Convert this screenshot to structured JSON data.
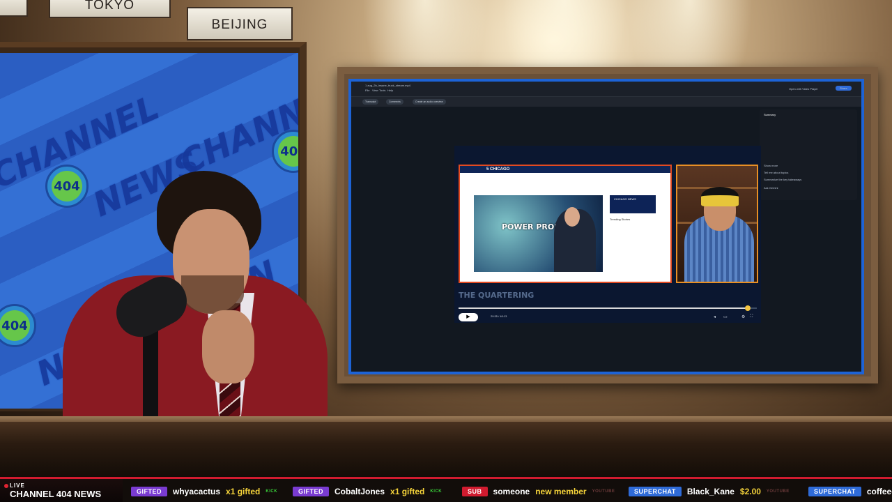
{
  "studio": {
    "clocks": [
      "TOKYO",
      "BEIJING"
    ],
    "backdrop_text": [
      "CHANNEL",
      "NEWS",
      "CHANNEL",
      "NEWS CHANN",
      "404"
    ]
  },
  "player": {
    "title": "1 aug_2b_insane_truck_stream.mp4",
    "menu": [
      "File",
      "View",
      "Tools",
      "Help"
    ],
    "open_with": "Open with Video Player",
    "share": "Share",
    "tabs": [
      "Transcript",
      "Comments",
      "Create an audio overview"
    ],
    "sidebar": {
      "heading": "Summary",
      "topics": [
        "Tell me about topics",
        "Summarize the key takeaways"
      ],
      "ask": "Ask Gemini",
      "show_more": "Show more"
    },
    "article": {
      "station": "5 CHICAGO",
      "headline": "POWER PROBLEMS",
      "side": "CHICAGO NEWS",
      "trending": "Trending Stories"
    },
    "channel_brand": "THE QUARTERING",
    "time": "29:35 / 40:13",
    "progress": 0.97
  },
  "ticker": {
    "live": "LIVE",
    "channel": "CHANNEL 404 NEWS",
    "items": [
      {
        "badge": "GIFTED",
        "badge_color": "#7a3bd1",
        "user": "whyacactus",
        "value": "x1 gifted",
        "source": "KICK",
        "source_color": "#3ad13a"
      },
      {
        "badge": "GIFTED",
        "badge_color": "#7a3bd1",
        "user": "CobaltJones",
        "value": "x1 gifted",
        "source": "KICK",
        "source_color": "#3ad13a"
      },
      {
        "badge": "SUB",
        "badge_color": "#d11b2f",
        "user": "someone",
        "value": "new member",
        "source": "YOUTUBE",
        "source_color": "#6b3a3a"
      },
      {
        "badge": "SUPERCHAT",
        "badge_color": "#2f6bd8",
        "user": "Black_Kane",
        "value": "$2.00",
        "source": "YOUTUBE",
        "source_color": "#6b3a3a"
      },
      {
        "badge": "SUPERCHAT",
        "badge_color": "#2f6bd8",
        "user": "coffeec",
        "value": "",
        "source": "",
        "source_color": "#6b3a3a"
      }
    ]
  }
}
